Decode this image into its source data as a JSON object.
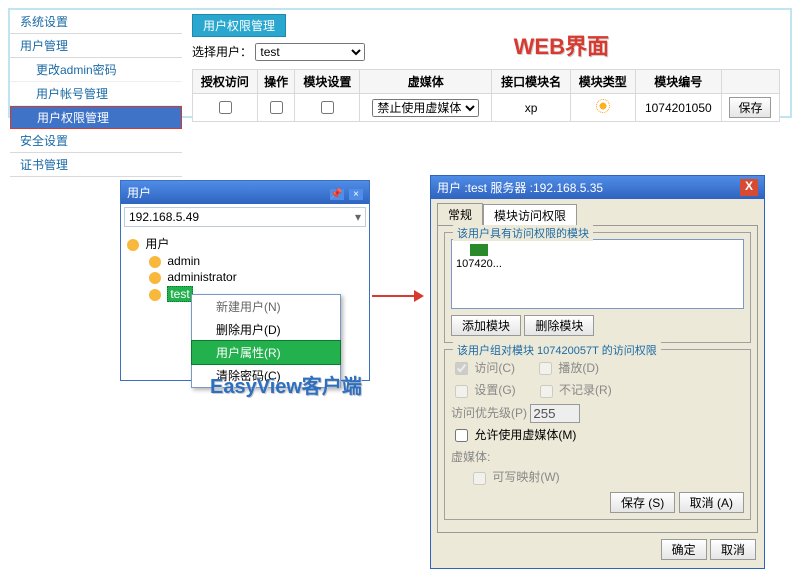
{
  "web": {
    "label": "WEB界面",
    "sidebar": {
      "items": [
        {
          "label": "系统设置"
        },
        {
          "label": "用户管理",
          "children": [
            {
              "label": "更改admin密码"
            },
            {
              "label": "用户帐号管理"
            },
            {
              "label": "用户权限管理",
              "active": true
            }
          ]
        },
        {
          "label": "安全设置"
        },
        {
          "label": "证书管理"
        }
      ]
    },
    "section_title": "用户权限管理",
    "select_user_label": "选择用户：",
    "select_user_value": "test",
    "table": {
      "headers": [
        "授权访问",
        "操作",
        "模块设置",
        "虚媒体",
        "接口模块名",
        "模块类型",
        "模块编号",
        ""
      ],
      "row": {
        "vm_select": "禁止使用虚媒体",
        "iface_name": "xp",
        "module_type_icon": "gear-icon",
        "module_id": "1074201050",
        "save": "保存"
      }
    }
  },
  "ev": {
    "label": "EasyView客户端",
    "window": {
      "title": "用户",
      "address": "192.168.5.49",
      "tree": {
        "root": "用户",
        "children": [
          "admin",
          "administrator",
          "test"
        ]
      },
      "ctx": [
        {
          "label": "新建用户(N)",
          "enabled": false
        },
        {
          "label": "删除用户(D)",
          "enabled": true
        },
        {
          "label": "用户属性(R)",
          "enabled": true,
          "hover": true
        },
        {
          "label": "清除密码(C)",
          "enabled": true
        }
      ]
    }
  },
  "dlg": {
    "title": "用户 :test 服务器 :192.168.5.35",
    "tabs": [
      "常规",
      "模块访问权限"
    ],
    "group1_title": "该用户具有访问权限的模块",
    "module_label": "107420...",
    "add_btn": "添加模块",
    "del_btn": "删除模块",
    "group2_title": "该用户组对模块 107420057T 的访问权限",
    "checks": {
      "access": "访问(C)",
      "broadcast": "播放(D)",
      "config": "设置(G)",
      "norecord": "不记录(R)",
      "priority_label": "访问优先级(P)",
      "priority_value": "255",
      "allow_vm": "允许使用虚媒体(M)",
      "vm_label": "虚媒体:",
      "writable": "可写映射(W)"
    },
    "save_btn": "保存 (S)",
    "cancel_inner_btn": "取消 (A)",
    "ok_btn": "确定",
    "cancel_btn": "取消"
  }
}
